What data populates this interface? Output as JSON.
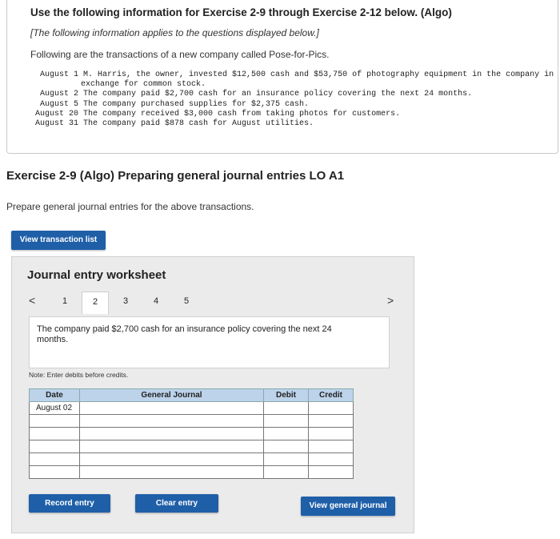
{
  "info": {
    "title": "Use the following information for Exercise 2-9 through Exercise 2-12 below. (Algo)",
    "subtitle": "[The following information applies to the questions displayed below.]",
    "intro": "Following are the transactions of a new company called Pose-for-Pics.",
    "transactions": [
      {
        "date": "August 1",
        "text": "M. Harris, the owner, invested $12,500 cash and $53,750 of photography equipment in the company in",
        "cont": "exchange for common stock."
      },
      {
        "date": "August 2",
        "text": "The company paid $2,700 cash for an insurance policy covering the next 24 months."
      },
      {
        "date": "August 5",
        "text": "The company purchased supplies for $2,375 cash."
      },
      {
        "date": "August 20",
        "text": "The company received $3,000 cash from taking photos for customers."
      },
      {
        "date": "August 31",
        "text": "The company paid $878 cash for August utilities."
      }
    ]
  },
  "exercise": {
    "title": "Exercise 2-9 (Algo) Preparing general journal entries LO A1",
    "description": "Prepare general journal entries for the above transactions."
  },
  "buttons": {
    "view_transactions": "View transaction list",
    "record": "Record entry",
    "clear": "Clear entry",
    "view_journal": "View general journal"
  },
  "worksheet": {
    "title": "Journal entry worksheet",
    "tabs": [
      "1",
      "2",
      "3",
      "4",
      "5"
    ],
    "active_tab": "2",
    "prev_glyph": "<",
    "next_glyph": ">",
    "description": "The company paid $2,700 cash for an insurance policy covering the next 24 months.",
    "note": "Note: Enter debits before credits.",
    "table": {
      "headers": [
        "Date",
        "General Journal",
        "Debit",
        "Credit"
      ],
      "first_date": "August 02"
    }
  },
  "colors": {
    "button": "#1f5fa8",
    "header": "#bcd3ea",
    "worksheet_bg": "#ebebeb"
  }
}
